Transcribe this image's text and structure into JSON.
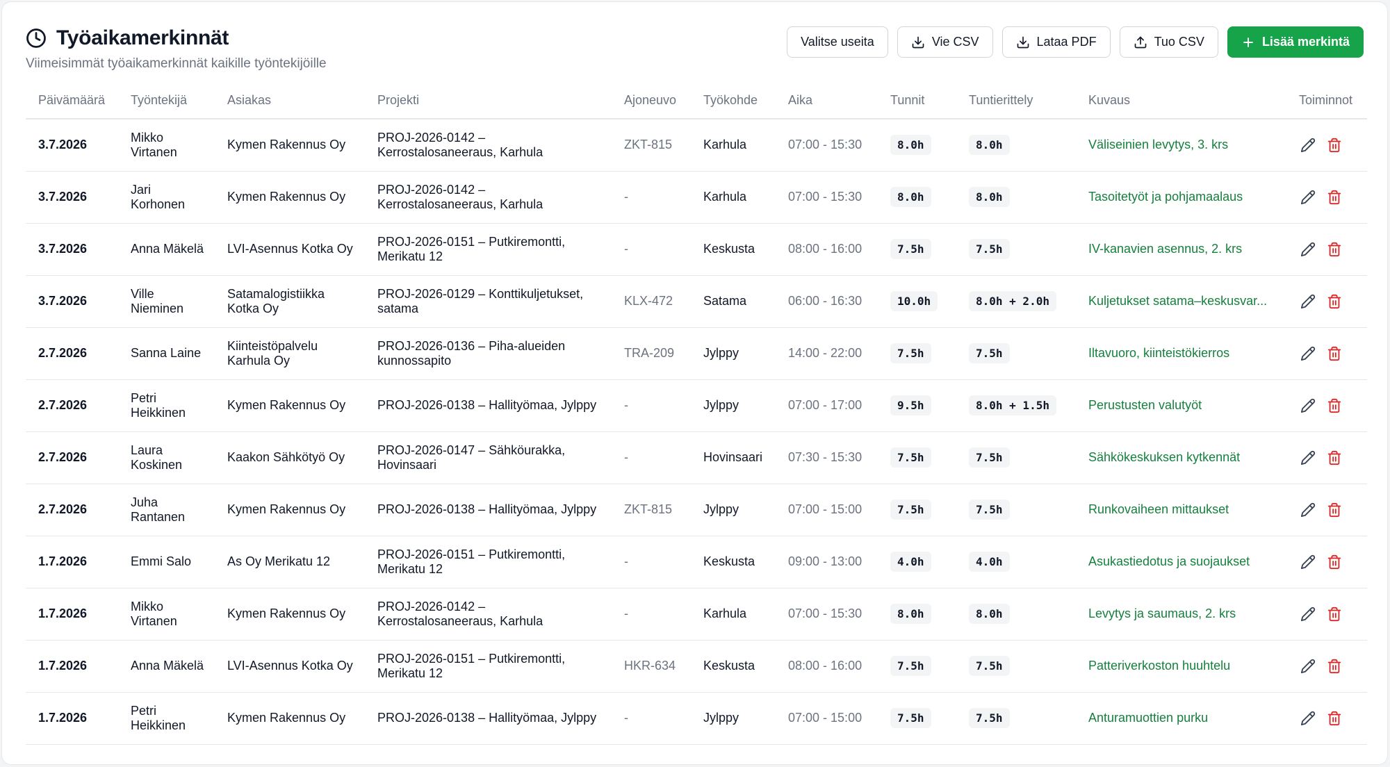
{
  "header": {
    "title": "Työaikamerkinnät",
    "subtitle": "Viimeisimmät työaikamerkinnät kaikille työntekijöille",
    "title_icon": "clock-icon"
  },
  "actions": {
    "select_multiple": "Valitse useita",
    "export_csv": "Vie CSV",
    "download_pdf": "Lataa PDF",
    "import_csv": "Tuo CSV",
    "add_entry": "Lisää merkintä"
  },
  "colors": {
    "primary": "#16a34a",
    "description": "#15803d",
    "delete": "#dc2626"
  },
  "columns": [
    "Päivämäärä",
    "Työntekijä",
    "Asiakas",
    "Projekti",
    "Ajoneuvo",
    "Työkohde",
    "Aika",
    "Tunnit",
    "Tuntierittely",
    "Kuvaus",
    "Toiminnot"
  ],
  "rows": [
    {
      "date": "3.7.2026",
      "employee": "Mikko Virtanen",
      "client": "Kymen Rakennus Oy",
      "project": "PROJ-2026-0142 – Kerrostalosaneeraus, Karhula",
      "vehicle": "ZKT-815",
      "site": "Karhula",
      "time": "07:00 - 15:30",
      "hours": "8.0h",
      "breakdown": "8.0h",
      "description": "Väliseinien levytys, 3. krs"
    },
    {
      "date": "3.7.2026",
      "employee": "Jari Korhonen",
      "client": "Kymen Rakennus Oy",
      "project": "PROJ-2026-0142 – Kerrostalosaneeraus, Karhula",
      "vehicle": "-",
      "site": "Karhula",
      "time": "07:00 - 15:30",
      "hours": "8.0h",
      "breakdown": "8.0h",
      "description": "Tasoitetyöt ja pohjamaalaus"
    },
    {
      "date": "3.7.2026",
      "employee": "Anna Mäkelä",
      "client": "LVI-Asennus Kotka Oy",
      "project": "PROJ-2026-0151 – Putkiremontti, Merikatu 12",
      "vehicle": "-",
      "site": "Keskusta",
      "time": "08:00 - 16:00",
      "hours": "7.5h",
      "breakdown": "7.5h",
      "description": "IV-kanavien asennus, 2. krs"
    },
    {
      "date": "3.7.2026",
      "employee": "Ville Nieminen",
      "client": "Satamalogistiikka Kotka Oy",
      "project": "PROJ-2026-0129 – Konttikuljetukset, satama",
      "vehicle": "KLX-472",
      "site": "Satama",
      "time": "06:00 - 16:30",
      "hours": "10.0h",
      "breakdown": "8.0h + 2.0h",
      "description": "Kuljetukset satama–keskusvar..."
    },
    {
      "date": "2.7.2026",
      "employee": "Sanna Laine",
      "client": "Kiinteistöpalvelu Karhula Oy",
      "project": "PROJ-2026-0136 – Piha-alueiden kunnossapito",
      "vehicle": "TRA-209",
      "site": "Jylppy",
      "time": "14:00 - 22:00",
      "hours": "7.5h",
      "breakdown": "7.5h",
      "description": "Iltavuoro, kiinteistökierros"
    },
    {
      "date": "2.7.2026",
      "employee": "Petri Heikkinen",
      "client": "Kymen Rakennus Oy",
      "project": "PROJ-2026-0138 – Hallityömaa, Jylppy",
      "vehicle": "-",
      "site": "Jylppy",
      "time": "07:00 - 17:00",
      "hours": "9.5h",
      "breakdown": "8.0h + 1.5h",
      "description": "Perustusten valutyöt"
    },
    {
      "date": "2.7.2026",
      "employee": "Laura Koskinen",
      "client": "Kaakon Sähkötyö Oy",
      "project": "PROJ-2026-0147 – Sähköurakka, Hovinsaari",
      "vehicle": "-",
      "site": "Hovinsaari",
      "time": "07:30 - 15:30",
      "hours": "7.5h",
      "breakdown": "7.5h",
      "description": "Sähkökeskuksen kytkennät"
    },
    {
      "date": "2.7.2026",
      "employee": "Juha Rantanen",
      "client": "Kymen Rakennus Oy",
      "project": "PROJ-2026-0138 – Hallityömaa, Jylppy",
      "vehicle": "ZKT-815",
      "site": "Jylppy",
      "time": "07:00 - 15:00",
      "hours": "7.5h",
      "breakdown": "7.5h",
      "description": "Runkovaiheen mittaukset"
    },
    {
      "date": "1.7.2026",
      "employee": "Emmi Salo",
      "client": "As Oy Merikatu 12",
      "project": "PROJ-2026-0151 – Putkiremontti, Merikatu 12",
      "vehicle": "-",
      "site": "Keskusta",
      "time": "09:00 - 13:00",
      "hours": "4.0h",
      "breakdown": "4.0h",
      "description": "Asukastiedotus ja suojaukset"
    },
    {
      "date": "1.7.2026",
      "employee": "Mikko Virtanen",
      "client": "Kymen Rakennus Oy",
      "project": "PROJ-2026-0142 – Kerrostalosaneeraus, Karhula",
      "vehicle": "-",
      "site": "Karhula",
      "time": "07:00 - 15:30",
      "hours": "8.0h",
      "breakdown": "8.0h",
      "description": "Levytys ja saumaus, 2. krs"
    },
    {
      "date": "1.7.2026",
      "employee": "Anna Mäkelä",
      "client": "LVI-Asennus Kotka Oy",
      "project": "PROJ-2026-0151 – Putkiremontti, Merikatu 12",
      "vehicle": "HKR-634",
      "site": "Keskusta",
      "time": "08:00 - 16:00",
      "hours": "7.5h",
      "breakdown": "7.5h",
      "description": "Patteriverkoston huuhtelu"
    },
    {
      "date": "1.7.2026",
      "employee": "Petri Heikkinen",
      "client": "Kymen Rakennus Oy",
      "project": "PROJ-2026-0138 – Hallityömaa, Jylppy",
      "vehicle": "-",
      "site": "Jylppy",
      "time": "07:00 - 15:00",
      "hours": "7.5h",
      "breakdown": "7.5h",
      "description": "Anturamuottien purku"
    }
  ]
}
